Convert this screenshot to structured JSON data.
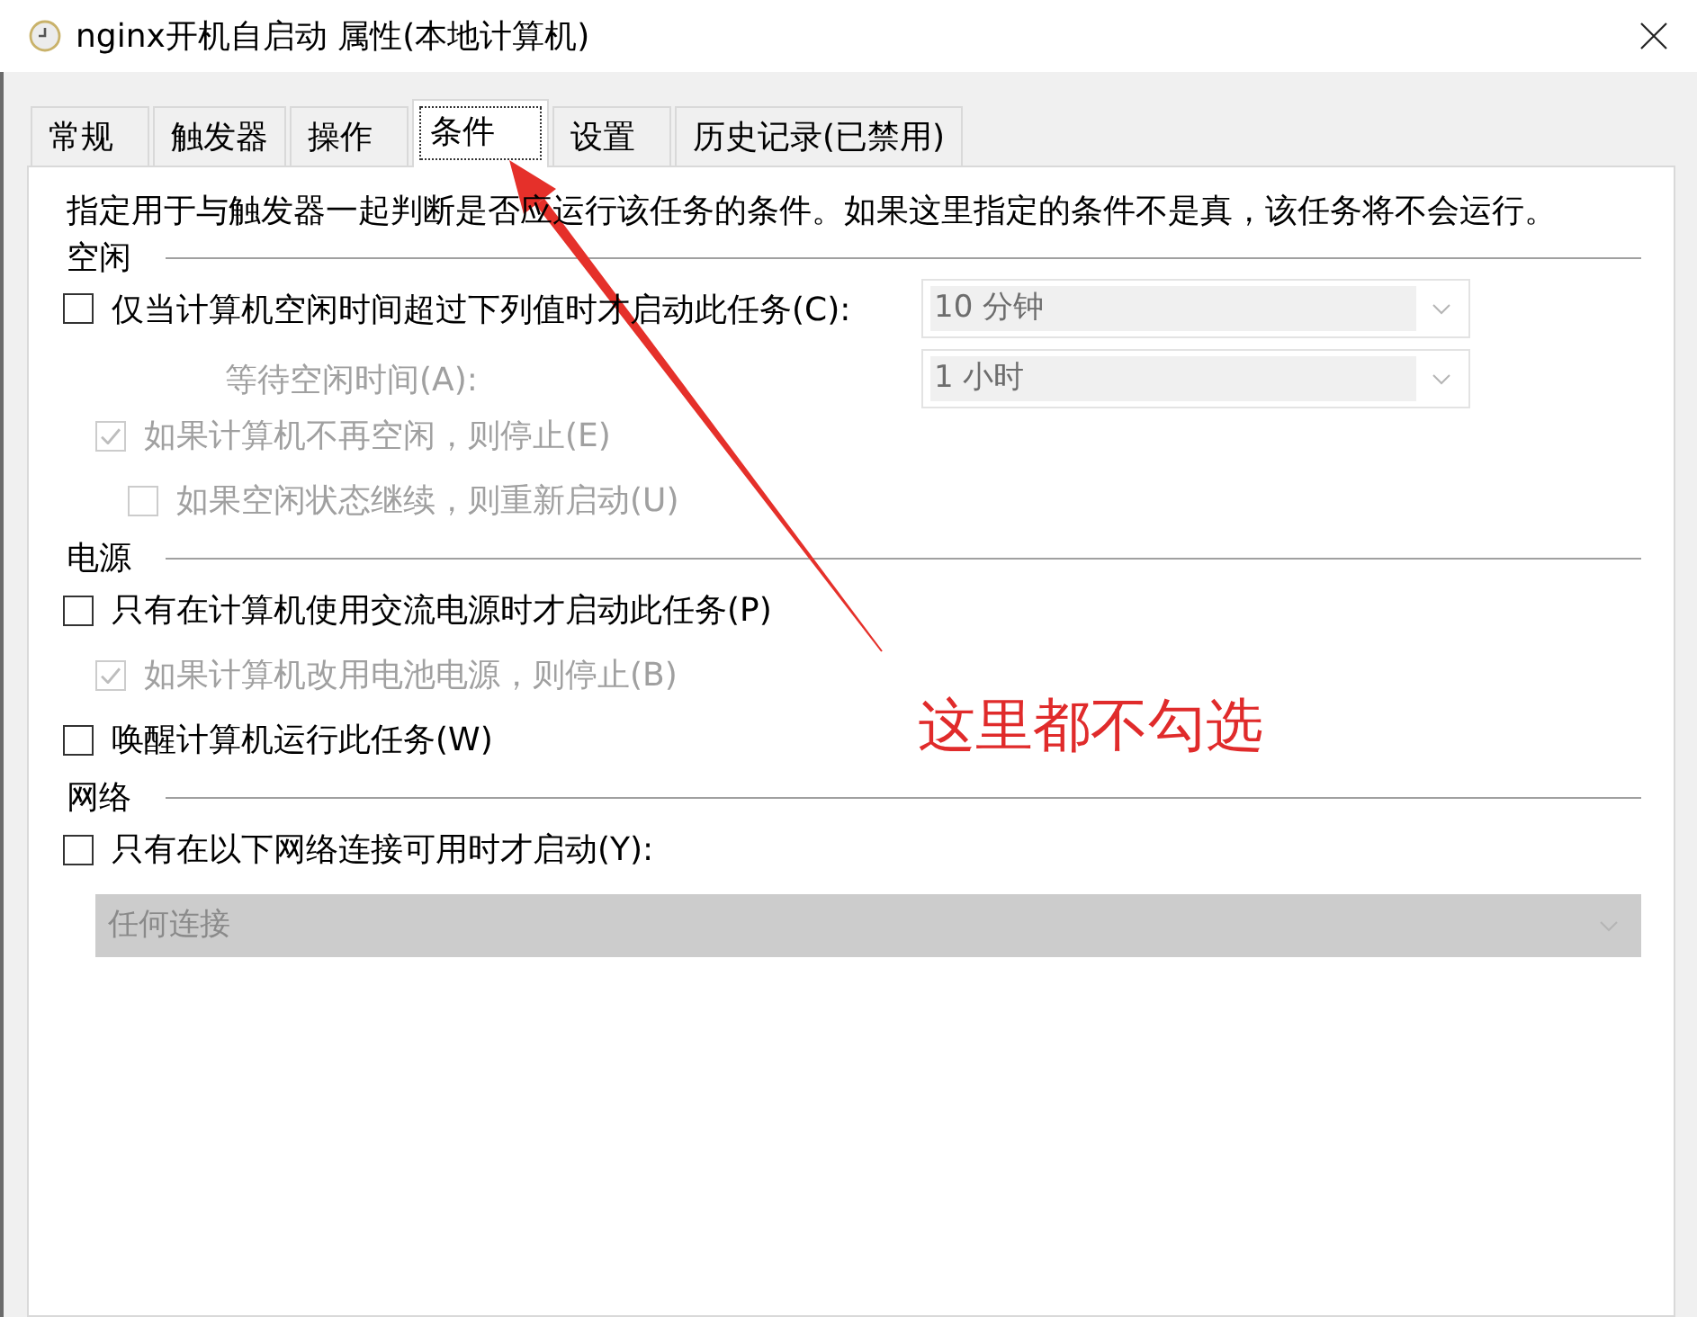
{
  "window": {
    "title": "nginx开机自启动 属性(本地计算机)"
  },
  "tabs": [
    {
      "label": "常规",
      "selected": false
    },
    {
      "label": "触发器",
      "selected": false
    },
    {
      "label": "操作",
      "selected": false
    },
    {
      "label": "条件",
      "selected": true
    },
    {
      "label": "设置",
      "selected": false
    },
    {
      "label": "历史记录(已禁用)",
      "selected": false
    }
  ],
  "description": "指定用于与触发器一起判断是否应运行该任务的条件。如果这里指定的条件不是真，该任务将不会运行。",
  "sections": [
    {
      "heading": "空闲",
      "rows": [
        {
          "kind": "checkbox",
          "label": "仅当计算机空闲时间超过下列值时才启动此任务(C):",
          "checked": false,
          "disabled": false,
          "dropdown": {
            "value": "10 分钟",
            "disabled": true
          },
          "children": [
            {
              "kind": "field",
              "label": "等待空闲时间(A):",
              "disabled": true,
              "dropdown": {
                "value": "1 小时",
                "disabled": true
              }
            },
            {
              "kind": "checkbox",
              "label": "如果计算机不再空闲，则停止(E)",
              "checked": true,
              "disabled": true,
              "children": [
                {
                  "kind": "checkbox",
                  "label": "如果空闲状态继续，则重新启动(U)",
                  "checked": false,
                  "disabled": true
                }
              ]
            }
          ]
        }
      ]
    },
    {
      "heading": "电源",
      "rows": [
        {
          "kind": "checkbox",
          "label": "只有在计算机使用交流电源时才启动此任务(P)",
          "checked": false,
          "disabled": false,
          "children": [
            {
              "kind": "checkbox",
              "label": "如果计算机改用电池电源，则停止(B)",
              "checked": true,
              "disabled": true
            }
          ]
        },
        {
          "kind": "checkbox",
          "label": "唤醒计算机运行此任务(W)",
          "checked": false,
          "disabled": false
        }
      ]
    },
    {
      "heading": "网络",
      "rows": [
        {
          "kind": "checkbox",
          "label": "只有在以下网络连接可用时才启动(Y):",
          "checked": false,
          "disabled": false,
          "children": [
            {
              "kind": "list",
              "value": "任何连接",
              "disabled": true
            }
          ]
        }
      ]
    }
  ],
  "annotation": {
    "text": "这里都不勾选"
  }
}
